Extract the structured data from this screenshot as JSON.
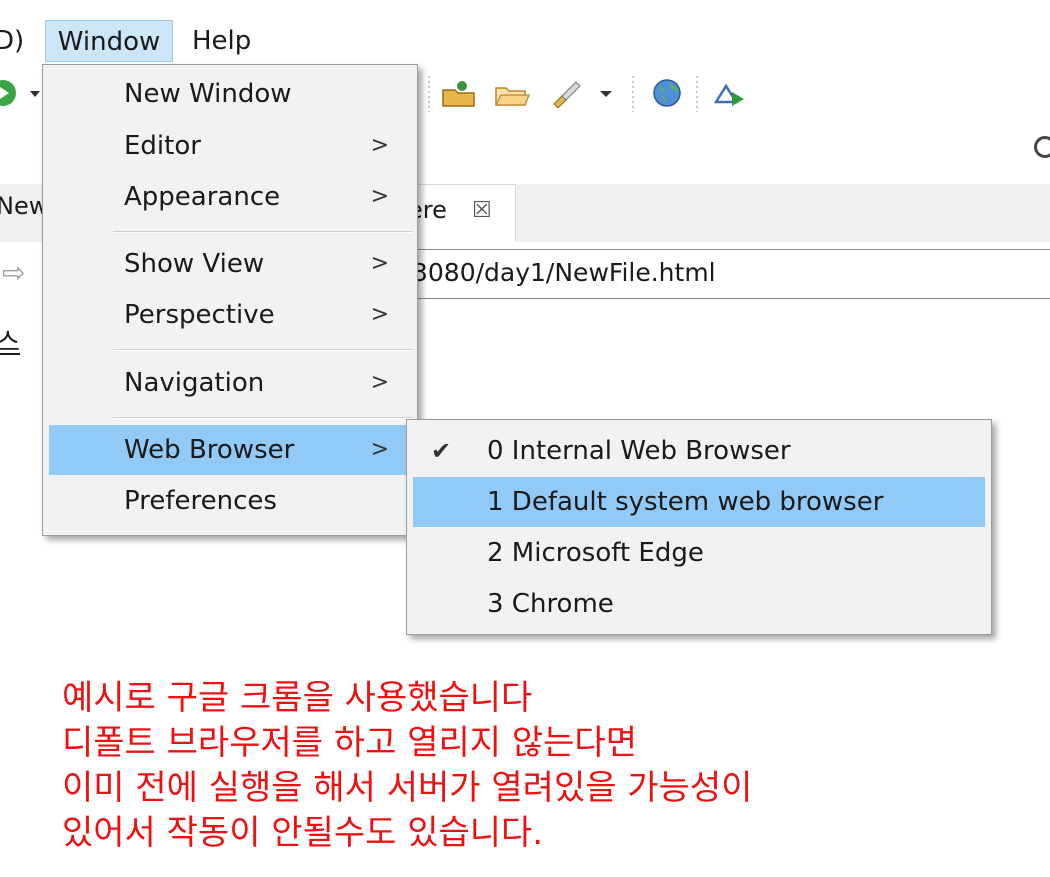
{
  "menubar": {
    "partial_item": "D)",
    "window_label": "Window",
    "help_label": "Help"
  },
  "editor": {
    "left_tab_fragment": "New",
    "right_tab_fragment": "ere",
    "tab_close_glyph": "☒",
    "url_fragment": "3080/day1/NewFile.html",
    "content_fragment": "스",
    "back_glyph": "⇨"
  },
  "window_menu": {
    "items": [
      {
        "label": "New Window",
        "submenu": false
      },
      {
        "label": "Editor",
        "submenu": true
      },
      {
        "label": "Appearance",
        "submenu": true
      },
      {
        "label": "Show View",
        "submenu": true
      },
      {
        "label": "Perspective",
        "submenu": true
      },
      {
        "label": "Navigation",
        "submenu": true
      },
      {
        "label": "Web Browser",
        "submenu": true,
        "highlighted": true
      },
      {
        "label": "Preferences",
        "submenu": false
      }
    ],
    "chevron_glyph": ">"
  },
  "web_browser_submenu": {
    "items": [
      {
        "label": "0 Internal Web Browser",
        "checked": true
      },
      {
        "label": "1 Default system web browser",
        "highlighted": true
      },
      {
        "label": "2 Microsoft Edge"
      },
      {
        "label": "3 Chrome"
      }
    ],
    "check_glyph": "✔"
  },
  "annotation": {
    "lines": [
      "예시로 구글 크롬을 사용했습니다",
      "디폴트 브라우저를 하고 열리지 않는다면",
      "이미 전에 실행을 해서 서버가 열려있을 가능성이",
      "있어서 작동이 안될수도 있습니다."
    ],
    "color": "#ee1111"
  },
  "colors": {
    "selection": "#91c9f7",
    "menubar_active": "#cde6f7",
    "menu_bg": "#f2f2f2"
  },
  "icons": [
    "run-icon",
    "open-folder-icon",
    "folder-icon",
    "brush-icon",
    "globe-icon",
    "web-browser-icon",
    "search-icon"
  ]
}
